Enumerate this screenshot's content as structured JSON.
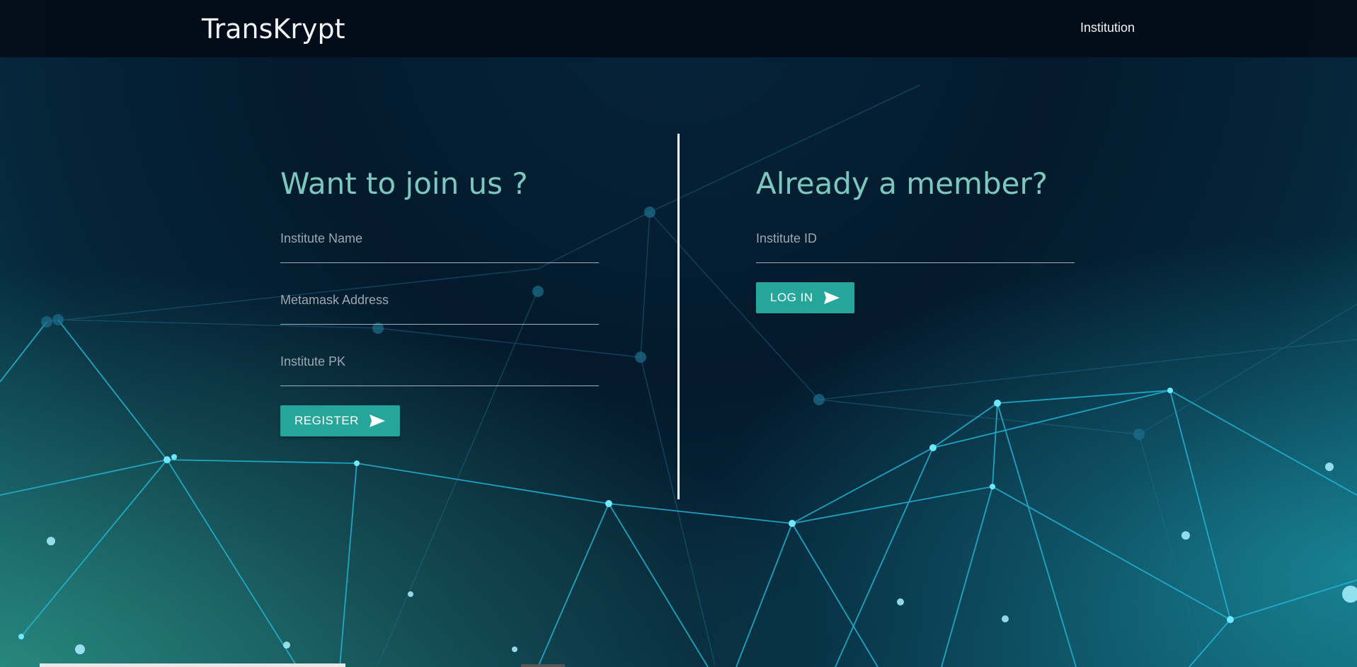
{
  "colors": {
    "accent": "#26a69a",
    "heading": "#7cc8bf",
    "navbar": "#020d18"
  },
  "navbar": {
    "brand": "TransKrypt",
    "link": "Institution"
  },
  "register": {
    "title": "Want to join us ?",
    "fields": [
      {
        "placeholder": "Institute Name",
        "value": ""
      },
      {
        "placeholder": "Metamask Address",
        "value": ""
      },
      {
        "placeholder": "Institute PK",
        "value": ""
      }
    ],
    "button_label": "REGISTER",
    "button_icon": "send-icon"
  },
  "login": {
    "title": "Already a member?",
    "fields": [
      {
        "placeholder": "Institute ID",
        "value": ""
      }
    ],
    "button_label": "LOG IN",
    "button_icon": "send-icon"
  }
}
